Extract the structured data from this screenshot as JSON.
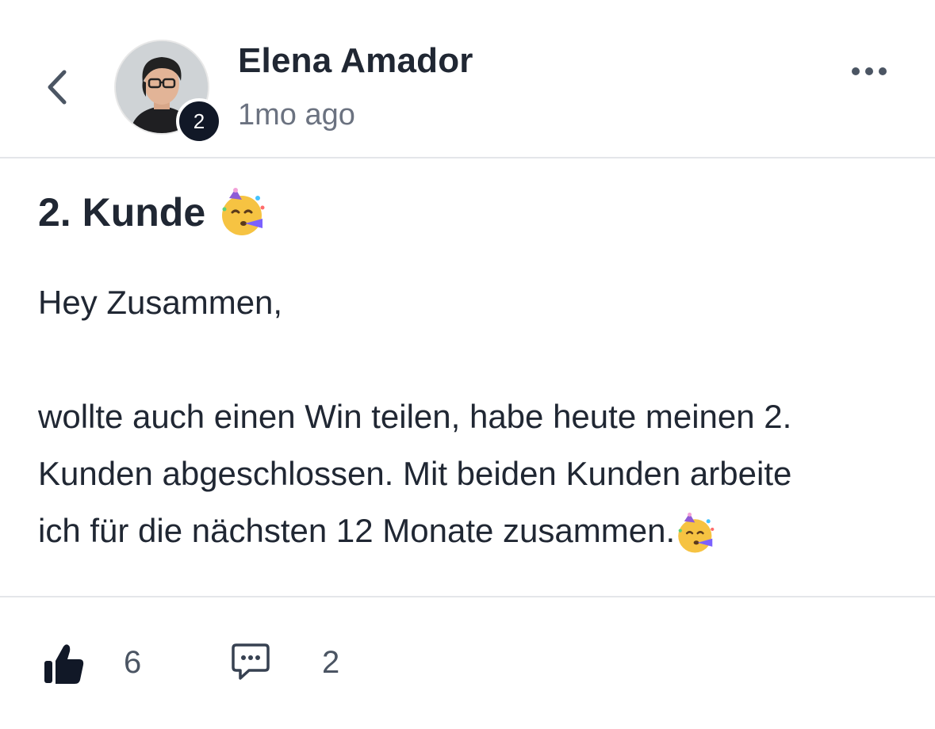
{
  "author": {
    "name": "Elena Amador",
    "level": "2",
    "time": "1mo ago"
  },
  "icons": {
    "back": "chevron-left-icon",
    "more": "more-horizontal-icon",
    "like": "thumbs-up-icon",
    "comment": "comment-bubble-icon",
    "emoji": "partying-face-emoji"
  },
  "post": {
    "title": "2. Kunde",
    "greeting": "Hey Zusammen,",
    "body_line1": "wollte auch einen Win teilen, habe heute meinen 2.",
    "body_line2": "Kunden abgeschlossen. Mit beiden Kunden arbeite",
    "body_line3": "ich für die nächsten 12 Monate zusammen."
  },
  "actions": {
    "like_count": "6",
    "comment_count": "2"
  },
  "colors": {
    "text": "#202733",
    "muted": "#6b7280",
    "badge": "#111827",
    "divider": "#e4e6ea"
  }
}
